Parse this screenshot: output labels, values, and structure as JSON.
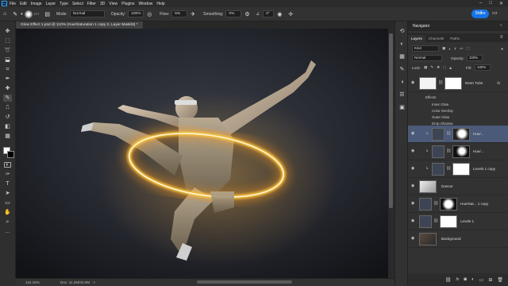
{
  "menubar": {
    "items": [
      "File",
      "Edit",
      "Image",
      "Layer",
      "Type",
      "Select",
      "Filter",
      "3D",
      "View",
      "Plugins",
      "Window",
      "Help"
    ]
  },
  "options": {
    "brush_size": "277",
    "mode_label": "Mode:",
    "mode_value": "Normal",
    "opacity_label": "Opacity:",
    "opacity_value": "100%",
    "flow_label": "Flow:",
    "flow_value": "5%",
    "smoothing_label": "Smoothing:",
    "smoothing_value": "0%",
    "angle_value": "0°",
    "share_label": "Share"
  },
  "document": {
    "tab_title": "Glow Effect 1.psd @ 110% (Hue/Saturation 1 copy 2, Layer Mask/8) *"
  },
  "status": {
    "zoom": "110.16%",
    "doc_info": "Doc: 11.2M/40.0M",
    "arrow": ">"
  },
  "panels": {
    "navigator_title": "Navigator",
    "tabs": [
      "Layers",
      "Channels",
      "Paths"
    ],
    "filter_kind": "Kind",
    "blend_mode": "Normal",
    "opacity_label": "Opacity:",
    "opacity_value": "100%",
    "lock_label": "Lock:",
    "fill_label": "Fill:",
    "fill_value": "100%"
  },
  "layers": [
    {
      "name": "Neon Tube",
      "fx": "fx"
    },
    {
      "name": "Hue/...",
      "selected": true
    },
    {
      "name": "Hue/..."
    },
    {
      "name": "Levels 1 copy"
    },
    {
      "name": "Dancer"
    },
    {
      "name": "Hue/Sat... 1 copy"
    },
    {
      "name": "Levels 1"
    },
    {
      "name": "Background"
    }
  ],
  "effects": {
    "header": "Effects",
    "items": [
      "Inner Glow",
      "Color Overlay",
      "Outer Glow",
      "Drop Shadow"
    ]
  },
  "colors": {
    "foreground": "#ffffff",
    "background": "#000000",
    "share": "#1473e6",
    "glow": "#ffc83a"
  }
}
